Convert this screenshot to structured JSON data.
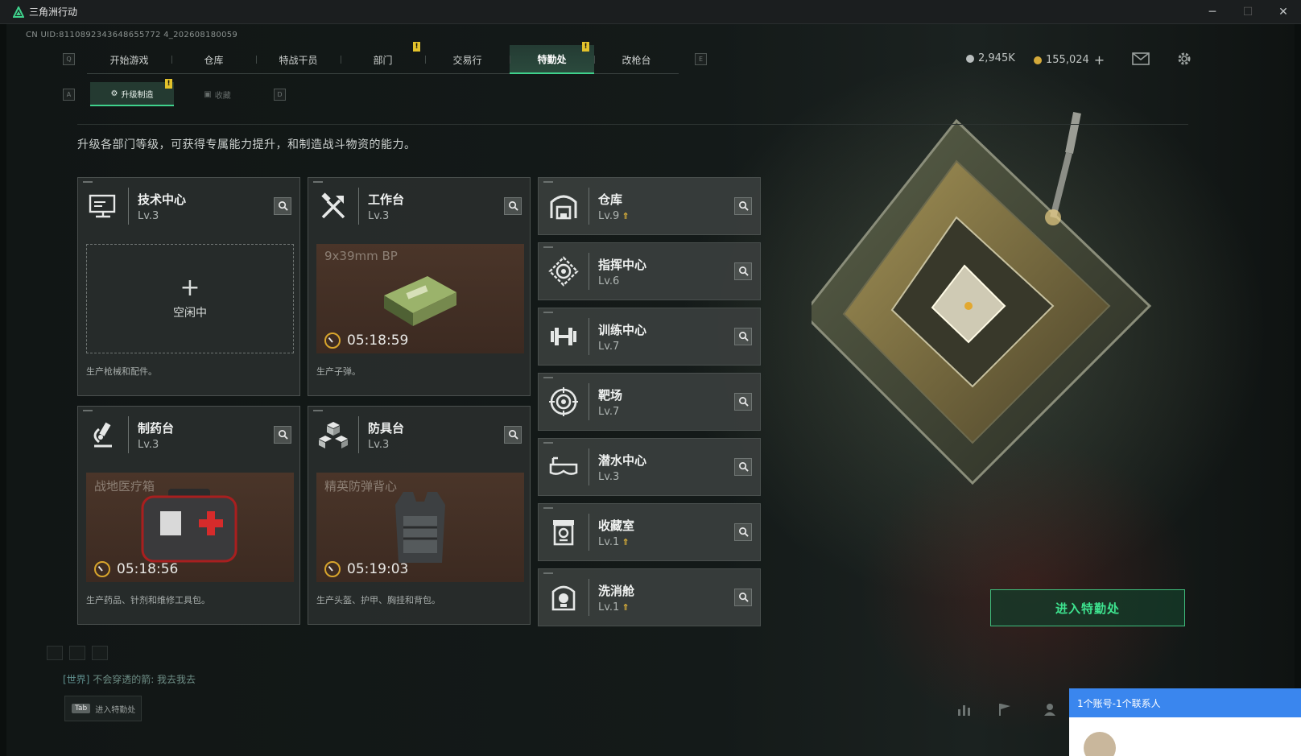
{
  "window": {
    "title": "三角洲行动",
    "minimize": "─",
    "maximize": "☐",
    "close": "✕"
  },
  "uid": "CN UID:8110892343648655772 4_202608180059",
  "nav": {
    "left_key": "Q",
    "right_key": "E",
    "tabs": [
      {
        "label": "开始游戏",
        "badge": ""
      },
      {
        "label": "仓库",
        "badge": ""
      },
      {
        "label": "特战干员",
        "badge": ""
      },
      {
        "label": "部门",
        "badge": "!"
      },
      {
        "label": "交易行",
        "badge": ""
      },
      {
        "label": "特勤处",
        "badge": "!"
      },
      {
        "label": "改枪台",
        "badge": ""
      }
    ]
  },
  "currency": {
    "silver": "2,945K",
    "gold": "155,024",
    "add": "+"
  },
  "subtabs": {
    "left_key": "A",
    "right_key": "D",
    "upgrade": "升级制造",
    "upgrade_badge": "!",
    "collect": "收藏"
  },
  "description": "升级各部门等级，可获得专属能力提升，和制造战斗物资的能力。",
  "production": [
    {
      "name": "技术中心",
      "level": "Lv.3",
      "icon": "computer-icon",
      "slot_state": "idle",
      "idle_label": "空闲中",
      "plus": "+",
      "footer": "生产枪械和配件。"
    },
    {
      "name": "工作台",
      "level": "Lv.3",
      "icon": "tools-icon",
      "slot_state": "busy",
      "item": "9x39mm BP",
      "timer": "05:18:59",
      "footer": "生产子弹。"
    },
    {
      "name": "制药台",
      "level": "Lv.3",
      "icon": "microscope-icon",
      "slot_state": "busy",
      "item": "战地医疗箱",
      "timer": "05:18:56",
      "footer": "生产药品、针剂和维修工具包。"
    },
    {
      "name": "防具台",
      "level": "Lv.3",
      "icon": "armor-blocks-icon",
      "slot_state": "busy",
      "item": "精英防弹背心",
      "timer": "05:19:03",
      "footer": "生产头盔、护甲、胸挂和背包。"
    }
  ],
  "facilities": [
    {
      "name": "仓库",
      "level": "Lv.9",
      "upgradable": true,
      "icon": "warehouse-icon"
    },
    {
      "name": "指挥中心",
      "level": "Lv.6",
      "upgradable": false,
      "icon": "command-icon"
    },
    {
      "name": "训练中心",
      "level": "Lv.7",
      "upgradable": false,
      "icon": "dumbbell-icon"
    },
    {
      "name": "靶场",
      "level": "Lv.7",
      "upgradable": false,
      "icon": "target-icon"
    },
    {
      "name": "潜水中心",
      "level": "Lv.3",
      "upgradable": false,
      "icon": "goggles-icon"
    },
    {
      "name": "收藏室",
      "level": "Lv.1",
      "upgradable": true,
      "icon": "collection-icon"
    },
    {
      "name": "洗消舱",
      "level": "Lv.1",
      "upgradable": true,
      "icon": "decon-icon"
    }
  ],
  "upgrade_mark": "⇑",
  "enter_button": "进入特勤处",
  "chat": {
    "channel": "[世界]",
    "message": "不会穿透的箭: 我去我去"
  },
  "tab_hint": {
    "key": "Tab",
    "label": "进入特勤处"
  },
  "notification": {
    "text": "1个账号-1个联系人"
  },
  "colors": {
    "accent": "#3fd18c",
    "badge": "#e3c22b",
    "upgrade": "#e3b53a",
    "notify": "#3a86ee"
  }
}
